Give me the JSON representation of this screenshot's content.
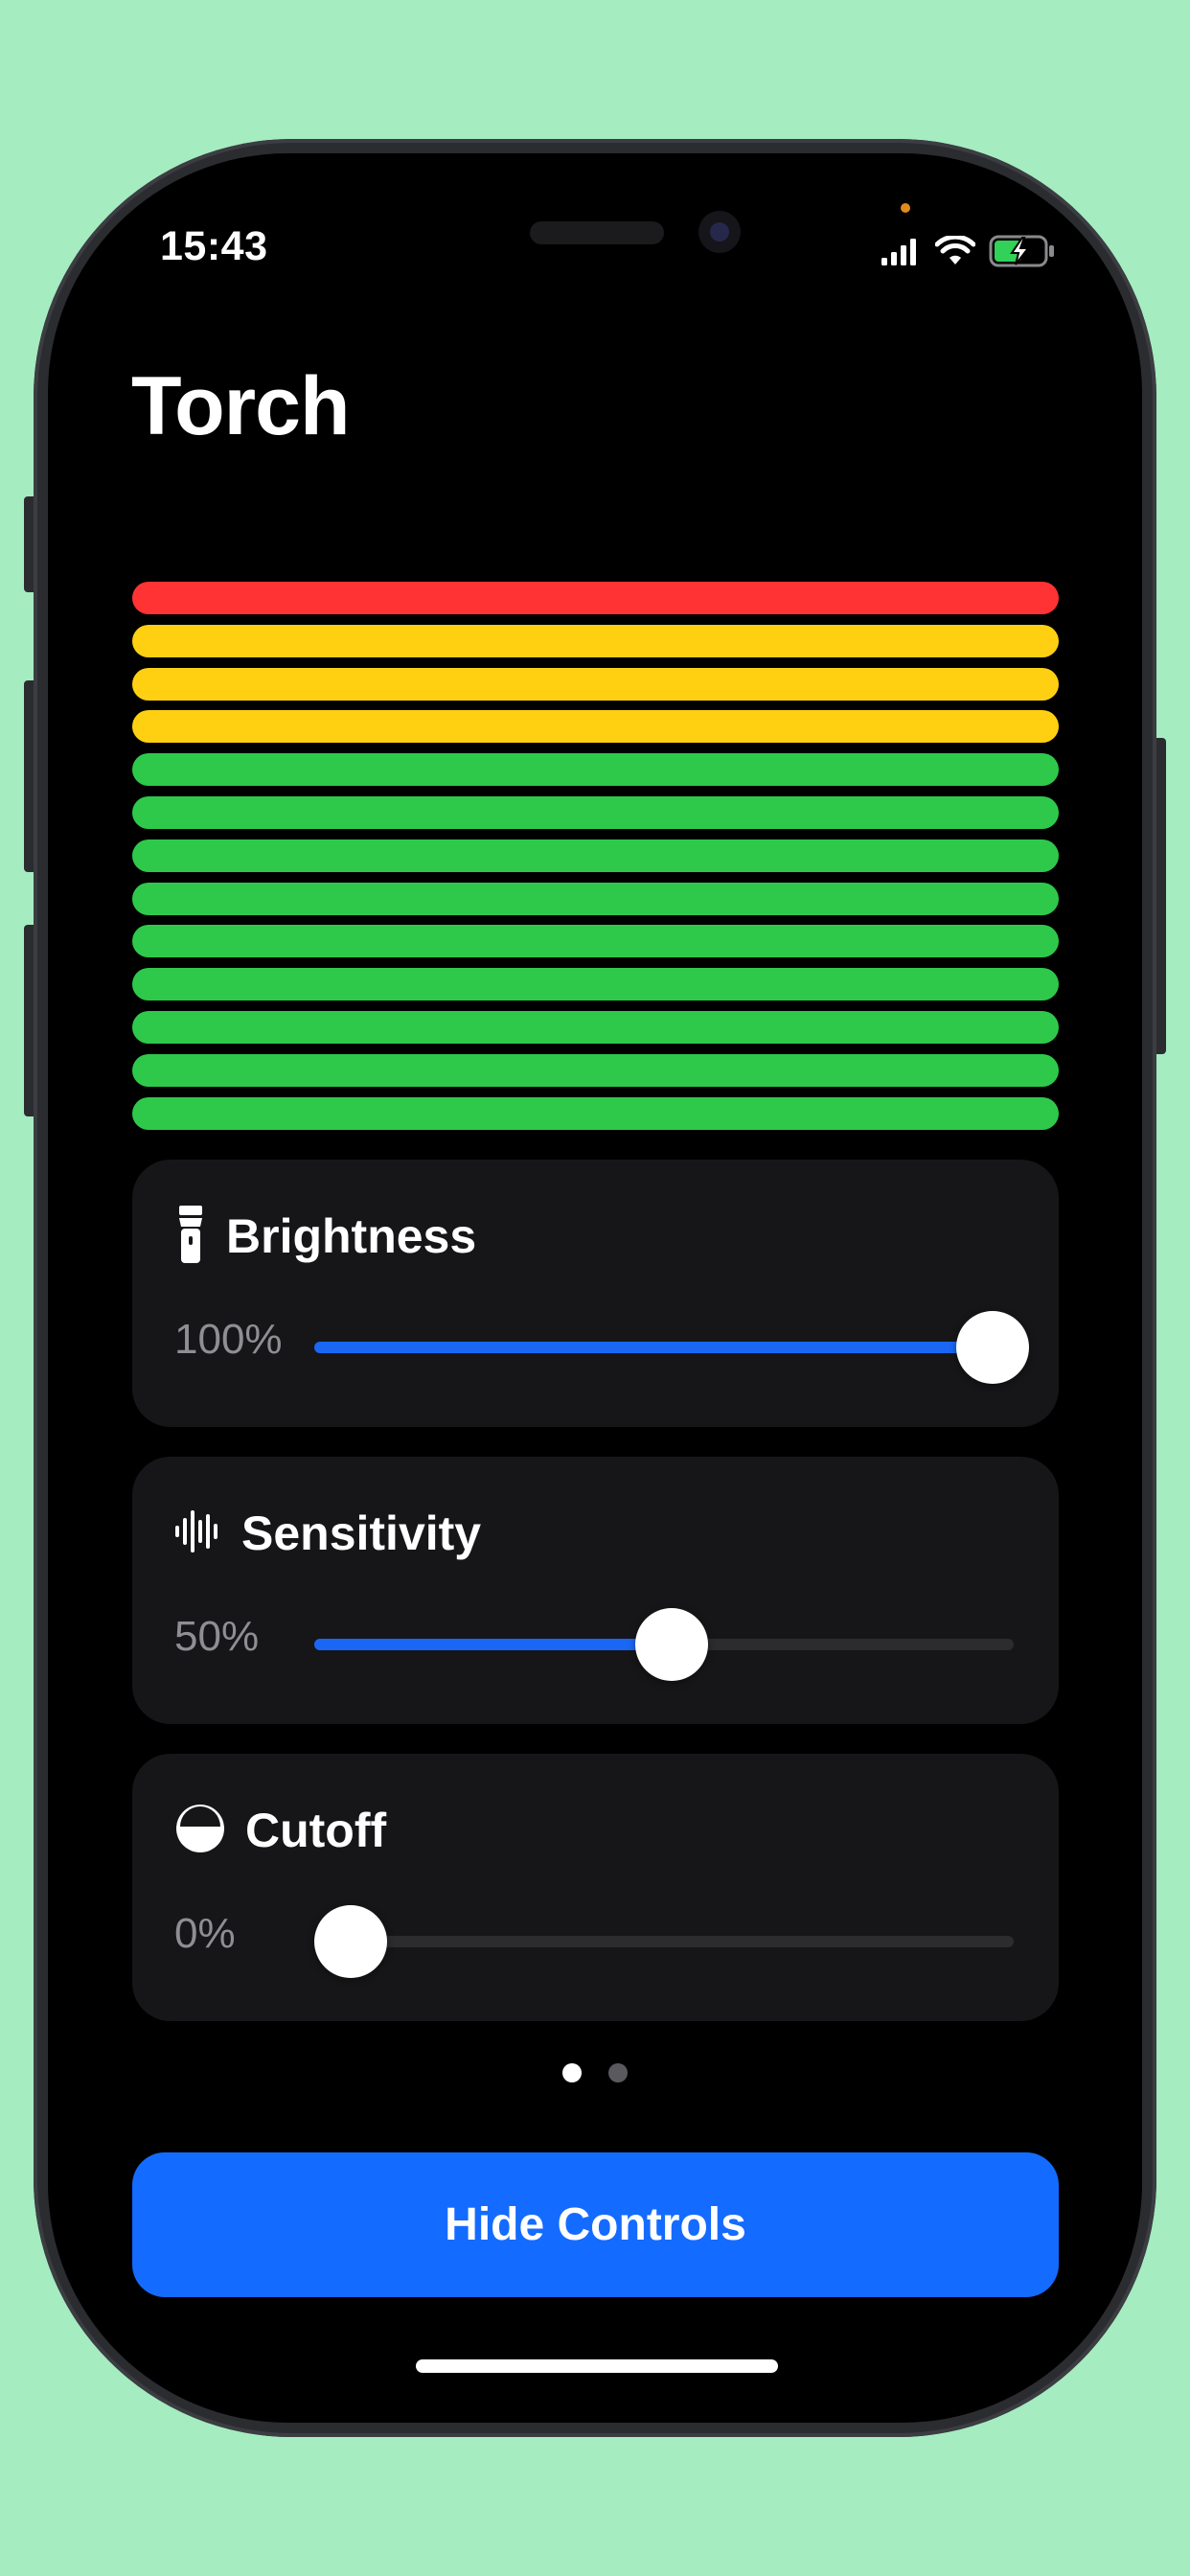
{
  "status_bar": {
    "time": "15:43",
    "icons": [
      "cellular-signal-icon",
      "wifi-icon",
      "battery-charging-icon"
    ]
  },
  "app": {
    "title": "Torch"
  },
  "meter": {
    "levels": [
      {
        "color": "#ff3333"
      },
      {
        "color": "#ffd012"
      },
      {
        "color": "#ffd012"
      },
      {
        "color": "#ffd012"
      },
      {
        "color": "#2ec94a"
      },
      {
        "color": "#2ec94a"
      },
      {
        "color": "#2ec94a"
      },
      {
        "color": "#2ec94a"
      },
      {
        "color": "#2ec94a"
      },
      {
        "color": "#2ec94a"
      },
      {
        "color": "#2ec94a"
      },
      {
        "color": "#2ec94a"
      },
      {
        "color": "#2ec94a"
      }
    ]
  },
  "controls": [
    {
      "key": "brightness",
      "icon": "flashlight-icon",
      "label": "Brightness",
      "value_text": "100%",
      "value": 1.0
    },
    {
      "key": "sensitivity",
      "icon": "waveform-icon",
      "label": "Sensitivity",
      "value_text": "50%",
      "value": 0.5
    },
    {
      "key": "cutoff",
      "icon": "half-circle-icon",
      "label": "Cutoff",
      "value_text": "0%",
      "value": 0.0
    }
  ],
  "pagination": {
    "pages": 2,
    "current": 0
  },
  "actions": {
    "hide_controls_label": "Hide Controls"
  },
  "colors": {
    "accent": "#146bff",
    "slider_fill": "#1a67f5",
    "card_background": "#161618",
    "value_text": "#8e8e93",
    "dot_active": "#ffffff",
    "dot_inactive": "#5a5a5e"
  }
}
